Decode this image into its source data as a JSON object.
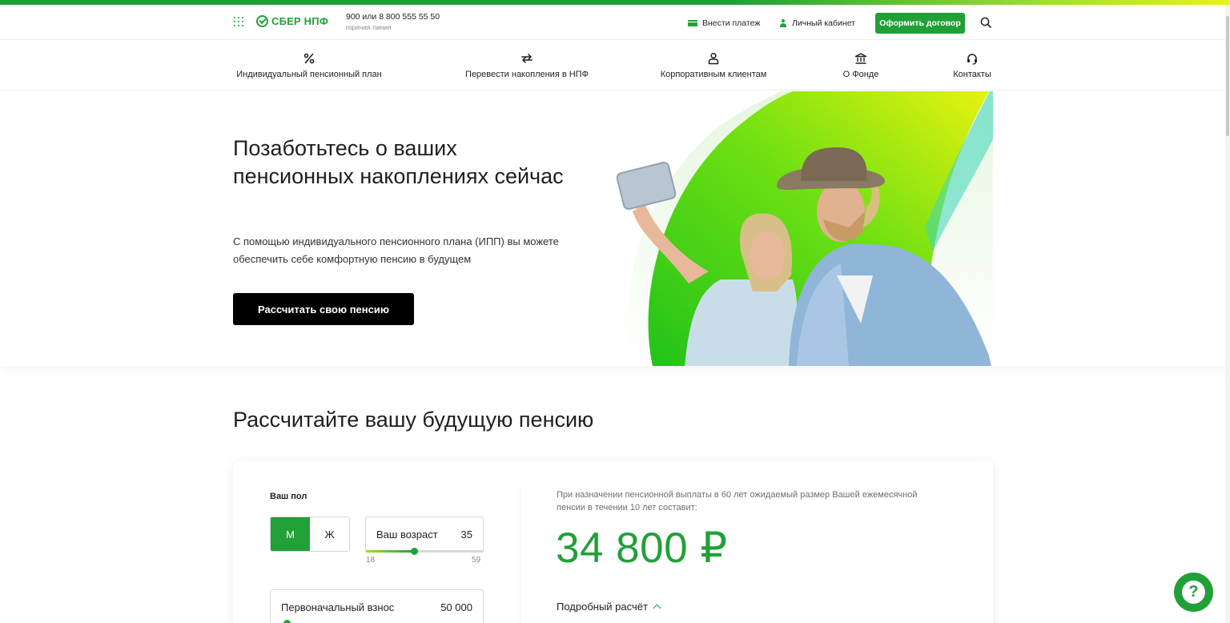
{
  "colors": {
    "brand": "#21a038",
    "accent_light": "#9fe02b",
    "button_dark": "#000000"
  },
  "header": {
    "logo_text": "СБЕР НПФ",
    "hotline_number": "900 или 8 800 555 55 50",
    "hotline_label": "горячая линия",
    "pay_link": "Внести платеж",
    "cabinet_link": "Личный кабинет",
    "contract_button": "Оформить договор"
  },
  "nav": {
    "items": [
      {
        "label": "Индивидуальный пенсионный план",
        "icon": "percent-icon"
      },
      {
        "label": "Перевести накопления в НПФ",
        "icon": "transfer-arrows-icon"
      },
      {
        "label": "Корпоративным клиентам",
        "icon": "corporate-user-icon"
      },
      {
        "label": "О Фонде",
        "icon": "bank-building-icon"
      },
      {
        "label": "Контакты",
        "icon": "headset-icon"
      }
    ]
  },
  "hero": {
    "title": "Позаботьтесь о ваших пенсионных накоплениях сейчас",
    "subtitle": "С помощью индивидуального пенсионного плана (ИПП) вы можете обеспечить себе комфортную пенсию в будущем",
    "button": "Рассчитать свою пенсию"
  },
  "calculator": {
    "title": "Рассчитайте вашу будущую пенсию",
    "gender_label": "Ваш пол",
    "gender_options": [
      "М",
      "Ж"
    ],
    "gender_selected": "М",
    "age_label": "Ваш возраст",
    "age_value": "35",
    "age_min": "18",
    "age_max": "59",
    "age_fraction": 0.41,
    "initial_fee_label": "Первоначальный взнос",
    "initial_fee_value": "50 000",
    "result_note": "При назначении пенсионной выплаты в 60 лет ожидаемый размер Вашей ежемесячной пенсии в течении 10 лет составит:",
    "result_amount": "34 800 ₽",
    "details_link": "Подробный расчёт"
  },
  "help": {
    "label": "?"
  }
}
